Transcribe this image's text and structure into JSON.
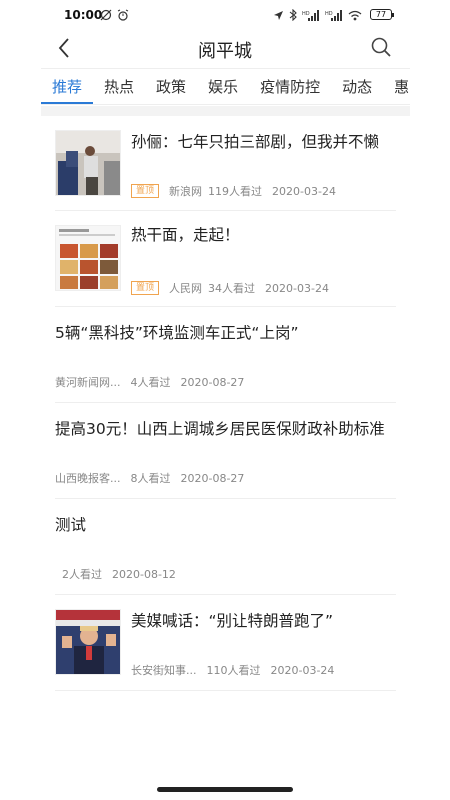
{
  "status_bar": {
    "time": "10:00",
    "battery": "77"
  },
  "header": {
    "title": "阅平城"
  },
  "tabs": [
    {
      "label": "推荐",
      "active": true
    },
    {
      "label": "热点",
      "active": false
    },
    {
      "label": "政策",
      "active": false
    },
    {
      "label": "娱乐",
      "active": false
    },
    {
      "label": "疫情防控",
      "active": false
    },
    {
      "label": "动态",
      "active": false
    },
    {
      "label": "惠",
      "active": false
    }
  ],
  "news": [
    {
      "title": "孙俪：七年只拍三部剧，但我并不懒",
      "badge": "置顶",
      "source": "新浪网",
      "views": "119人看过",
      "date": "2020-03-24",
      "thumb": "photo-man-office"
    },
    {
      "title": "热干面，走起！",
      "badge": "置顶",
      "source": "人民网",
      "views": "34人看过",
      "date": "2020-03-24",
      "thumb": "food-collage"
    },
    {
      "title": "5辆“黑科技”环境监测车正式“上岗”",
      "badge": "",
      "source": "黄河新闻网...",
      "views": "4人看过",
      "date": "2020-08-27"
    },
    {
      "title": "提高30元！山西上调城乡居民医保财政补助标准",
      "badge": "",
      "source": "山西晚报客...",
      "views": "8人看过",
      "date": "2020-08-27"
    },
    {
      "title": "测试",
      "badge": "",
      "source": "",
      "views": "2人看过",
      "date": "2020-08-12"
    },
    {
      "title": "美媒喊话：“别让特朗普跑了”",
      "badge": "",
      "source": "长安街知事...",
      "views": "110人看过",
      "date": "2020-03-24",
      "thumb": "photo-speaker"
    }
  ]
}
